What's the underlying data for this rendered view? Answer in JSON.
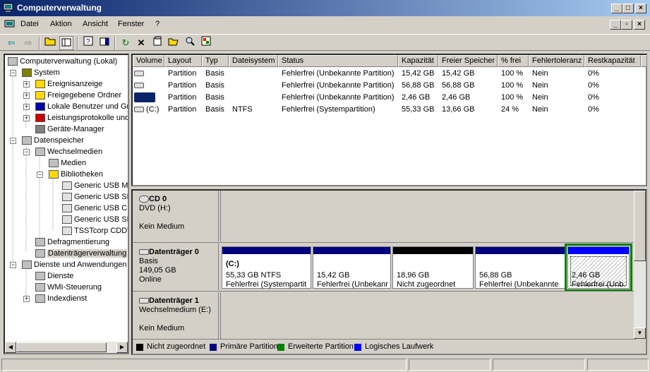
{
  "window": {
    "title": "Computerverwaltung"
  },
  "menu": [
    "Datei",
    "Aktion",
    "Ansicht",
    "Fenster",
    "?"
  ],
  "tree": {
    "items": [
      {
        "label": "Computerverwaltung (Lokal)",
        "icon": "computer-icon"
      },
      {
        "label": "System",
        "icon": "system-tools-icon"
      },
      {
        "label": "Ereignisanzeige",
        "icon": "event-viewer-icon"
      },
      {
        "label": "Freigegebene Ordner",
        "icon": "shared-folder-icon"
      },
      {
        "label": "Lokale Benutzer und Gr",
        "icon": "users-icon"
      },
      {
        "label": "Leistungsprotokolle und",
        "icon": "performance-icon"
      },
      {
        "label": "Geräte-Manager",
        "icon": "device-manager-icon"
      },
      {
        "label": "Datenspeicher",
        "icon": "storage-icon"
      },
      {
        "label": "Wechselmedien",
        "icon": "removable-storage-icon"
      },
      {
        "label": "Medien",
        "icon": "media-icon"
      },
      {
        "label": "Bibliotheken",
        "icon": "folder-icon"
      },
      {
        "label": "Generic USB MS",
        "icon": "drive-icon"
      },
      {
        "label": "Generic USB SD",
        "icon": "drive-icon"
      },
      {
        "label": "Generic USB CF",
        "icon": "drive-icon"
      },
      {
        "label": "Generic USB SM",
        "icon": "drive-icon"
      },
      {
        "label": "TSSTcorp CDDV",
        "icon": "drive-icon"
      },
      {
        "label": "Defragmentierung",
        "icon": "defrag-icon"
      },
      {
        "label": "Datenträgerverwaltung",
        "icon": "disk-management-icon"
      },
      {
        "label": "Dienste und Anwendungen",
        "icon": "services-apps-icon"
      },
      {
        "label": "Dienste",
        "icon": "services-icon"
      },
      {
        "label": "WMI-Steuerung",
        "icon": "wmi-icon"
      },
      {
        "label": "Indexdienst",
        "icon": "index-service-icon"
      }
    ]
  },
  "columns": [
    "Volume",
    "Layout",
    "Typ",
    "Dateisystem",
    "Status",
    "Kapazität",
    "Freier Speicher",
    "% frei",
    "Fehlertoleranz",
    "Restkapazität"
  ],
  "rows": [
    [
      "",
      "Partition",
      "Basis",
      "",
      "Fehlerfrei (Unbekannte Partition)",
      "15,42 GB",
      "15,42 GB",
      "100 %",
      "Nein",
      "0%"
    ],
    [
      "",
      "Partition",
      "Basis",
      "",
      "Fehlerfrei (Unbekannte Partition)",
      "56,88 GB",
      "56,88 GB",
      "100 %",
      "Nein",
      "0%"
    ],
    [
      "",
      "Partition",
      "Basis",
      "",
      "Fehlerfrei (Unbekannte Partition)",
      "2,46 GB",
      "2,46 GB",
      "100 %",
      "Nein",
      "0%"
    ],
    [
      "(C:)",
      "Partition",
      "Basis",
      "NTFS",
      "Fehlerfrei (Systempartition)",
      "55,33 GB",
      "13,66 GB",
      "24 %",
      "Nein",
      "0%"
    ]
  ],
  "disks": [
    {
      "name": "CD 0",
      "l1": "DVD (H:)",
      "l2": "",
      "l3": "Kein Medium",
      "l4": ""
    },
    {
      "name": "Datenträger 0",
      "l1": "Basis",
      "l2": "149,05 GB",
      "l3": "Online",
      "l4": ""
    },
    {
      "name": "Datenträger 1",
      "l1": "Wechselmedium (E:)",
      "l2": "",
      "l3": "Kein Medium",
      "l4": ""
    }
  ],
  "partitions": [
    {
      "title": "(C:)",
      "size": "55,33 GB NTFS",
      "status": "Fehlerfrei (Systempartit",
      "color": "#00007f"
    },
    {
      "title": "",
      "size": "15,42 GB",
      "status": "Fehlerfrei (Unbekanr",
      "color": "#00007f"
    },
    {
      "title": "",
      "size": "18,96 GB",
      "status": "Nicht zugeordnet",
      "color": "#000000"
    },
    {
      "title": "",
      "size": "56,88 GB",
      "status": "Fehlerfrei (Unbekannte",
      "color": "#00007f"
    },
    {
      "title": "",
      "size": "2,46 GB",
      "status": "Fehlerfrei (Unb.",
      "color": "#0000ff"
    }
  ],
  "legend": [
    {
      "label": "Nicht zugeordnet",
      "color": "#000000"
    },
    {
      "label": "Primäre Partition",
      "color": "#00007f"
    },
    {
      "label": "Erweiterte Partition",
      "color": "#008000"
    },
    {
      "label": "Logisches Laufwerk",
      "color": "#0000ff"
    }
  ],
  "colors": {
    "titlebar_start": "#0a246a",
    "titlebar_end": "#a6caf0",
    "selection": "#0a246a",
    "extended_border": "#008000"
  }
}
